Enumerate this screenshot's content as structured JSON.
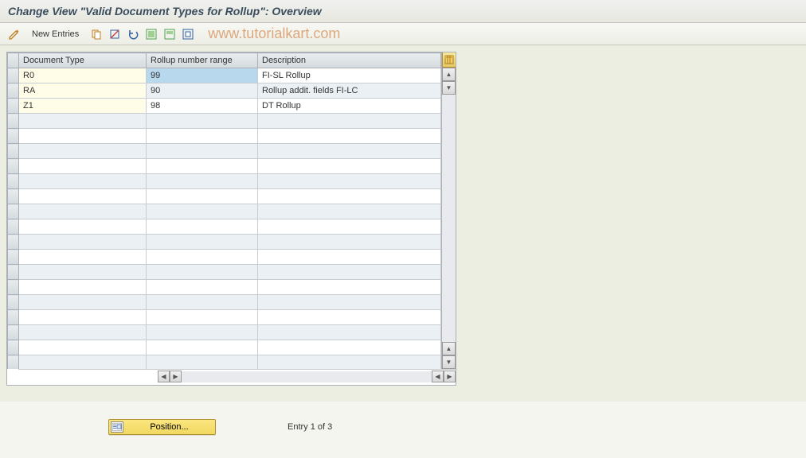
{
  "title": "Change View \"Valid Document Types for Rollup\": Overview",
  "toolbar": {
    "new_entries_label": "New Entries"
  },
  "watermark": "www.tutorialkart.com",
  "table": {
    "columns": {
      "doctype": "Document Type",
      "rollup": "Rollup number range",
      "desc": "Description"
    },
    "rows": [
      {
        "doctype": "R0",
        "rollup": "99",
        "desc": "FI-SL Rollup"
      },
      {
        "doctype": "RA",
        "rollup": "90",
        "desc": "Rollup addit. fields FI-LC"
      },
      {
        "doctype": "Z1",
        "rollup": "98",
        "desc": "DT Rollup"
      }
    ]
  },
  "footer": {
    "position_label": "Position...",
    "entry_text": "Entry 1 of 3"
  }
}
